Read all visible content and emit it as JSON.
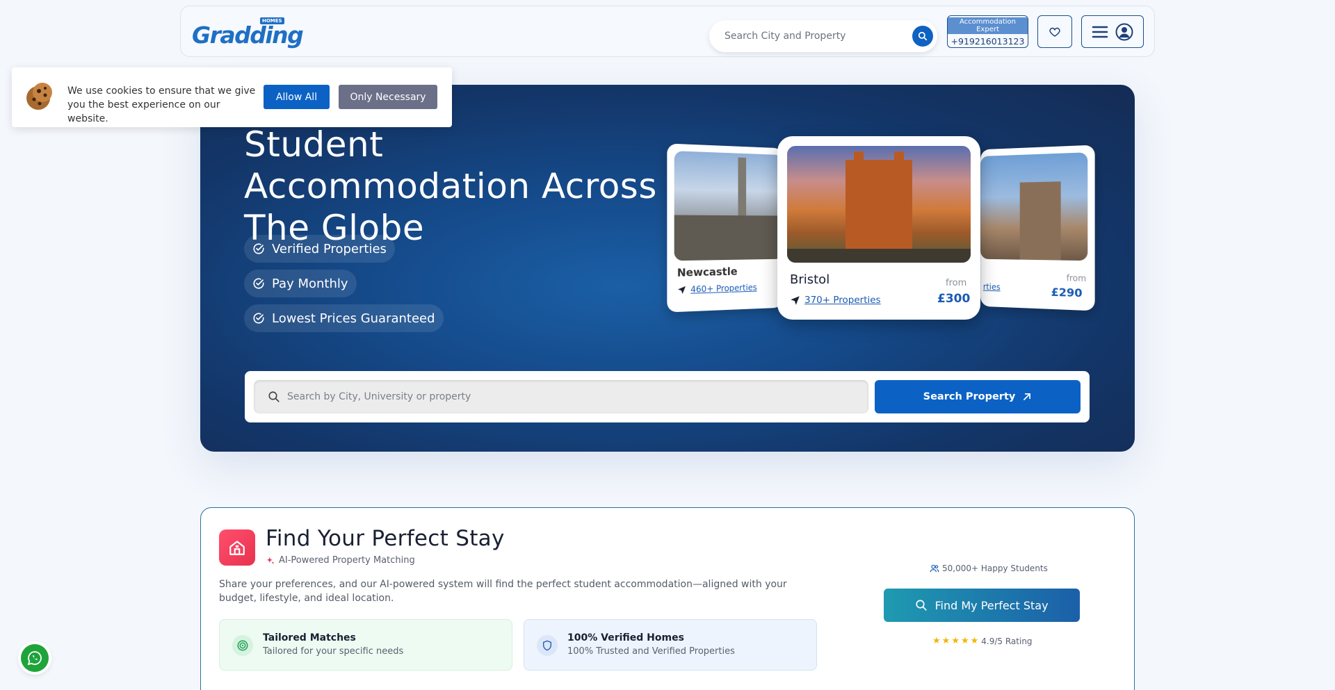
{
  "header": {
    "logo_text": "Gradding",
    "logo_badge": "HOMES",
    "search_placeholder": "Search City and Property",
    "expert_label": "Accommodation Expert",
    "expert_phone": "+919216013123"
  },
  "cookie": {
    "message": "We use cookies to ensure that we give you the best experience on our website.",
    "allow_label": "Allow All",
    "necessary_label": "Only Necessary"
  },
  "hero": {
    "title": "Student Accommodation Across The Globe",
    "features": [
      "Verified Properties",
      "Pay Monthly",
      "Lowest Prices Guaranteed"
    ],
    "search_placeholder": "Search by City, University or property",
    "search_button": "Search Property",
    "cards": {
      "left": {
        "city": "Newcastle",
        "properties": "460+ Properties"
      },
      "center": {
        "city": "Bristol",
        "properties": "370+ Properties",
        "from": "from",
        "price": "£300"
      },
      "right": {
        "properties": "rties",
        "from": "from",
        "price": "£290"
      }
    }
  },
  "stay": {
    "title": "Find Your Perfect Stay",
    "subtitle": "AI-Powered Property Matching",
    "description": "Share your preferences, and our AI-powered system will find the perfect student accommodation—aligned with your budget, lifestyle, and ideal location.",
    "features": [
      {
        "title": "Tailored Matches",
        "sub": "Tailored for your specific needs"
      },
      {
        "title": "100% Verified Homes",
        "sub": "100% Trusted and Verified Properties"
      }
    ],
    "happy": "50,000+ Happy Students",
    "button": "Find My Perfect Stay",
    "rating": "4.9/5 Rating"
  },
  "colors": {
    "primary": "#0b62c4",
    "hero_dark": "#142c55",
    "accent_red": "#e8324f",
    "whatsapp": "#1fa33b"
  }
}
